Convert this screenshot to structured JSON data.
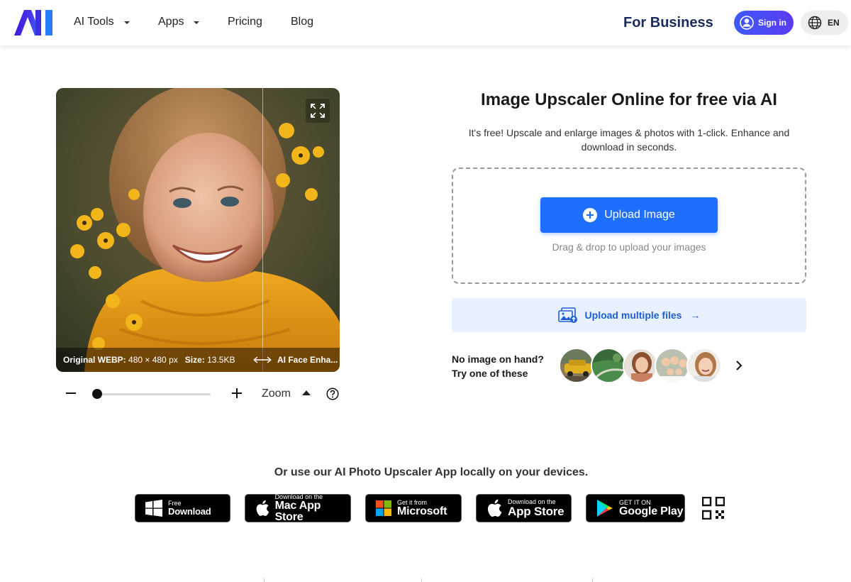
{
  "nav": {
    "logo_text": "AI",
    "items": [
      {
        "label": "AI Tools",
        "has_caret": true
      },
      {
        "label": "Apps",
        "has_caret": true
      },
      {
        "label": "Pricing",
        "has_caret": false
      },
      {
        "label": "Blog",
        "has_caret": false
      }
    ],
    "for_business": "For Business",
    "signin_label": "Sign in",
    "lang_label": "EN"
  },
  "preview": {
    "info_original_label": "Original WEBP:",
    "info_original_value": "480 × 480 px",
    "info_size_label": "Size:",
    "info_size_value": "13.5KB",
    "info_ai_label": "AI Face Enha..."
  },
  "zoom": {
    "label": "Zoom",
    "level": 0
  },
  "main": {
    "title": "Image Upscaler Online for free via AI",
    "subtitle": "It's free! Upscale and enlarge images & photos with 1-click. Enhance and download in seconds.",
    "upload_label": "Upload Image",
    "drag_text": "Drag & drop to upload your images",
    "multi_label": "Upload multiple files",
    "multi_arrow": "→",
    "noimg_line1": "No image on hand?",
    "noimg_line2": "Try one of these"
  },
  "apps": {
    "title": "Or use our AI Photo Upscaler App locally on your devices.",
    "stores": [
      {
        "small": "Free",
        "big": "Download",
        "icon": "windows-icon"
      },
      {
        "small": "Download on the",
        "big": "Mac App Store",
        "icon": "apple-icon"
      },
      {
        "small": "Get it from",
        "big": "Microsoft",
        "icon": "microsoft-icon"
      },
      {
        "small": "Download on the",
        "big": "App Store",
        "icon": "apple-icon"
      },
      {
        "small": "GET IT ON",
        "big": "Google Play",
        "icon": "google-play-icon"
      }
    ]
  },
  "colors": {
    "primary": "#1e6fff",
    "signin_gradient_start": "#3d5afe",
    "signin_gradient_end": "#5b3bf0",
    "brand_navy": "#1b2a5c",
    "multi_bg": "#e8f1ff"
  }
}
